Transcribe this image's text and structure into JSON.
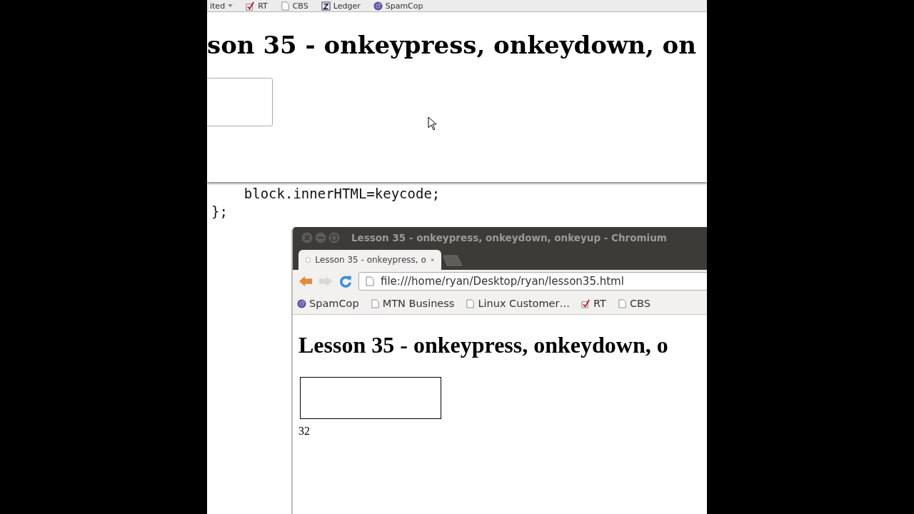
{
  "back_browser": {
    "bookmarks": [
      {
        "label": "ited",
        "kind": "dropdown"
      },
      {
        "label": "RT",
        "kind": "check"
      },
      {
        "label": "CBS",
        "kind": "page"
      },
      {
        "label": "Ledger",
        "kind": "ledger"
      },
      {
        "label": "SpamCop",
        "kind": "spiral"
      }
    ],
    "heading": "son 35 - onkeypress, onkeydown, on"
  },
  "editor": {
    "code_lines": [
      "    block.innerHTML=keycode;",
      "};"
    ]
  },
  "front_browser": {
    "title": "Lesson 35 - onkeypress, onkeydown, onkeyup - Chromium",
    "tabs": [
      {
        "label": "Lesson 35 - onkeypress, o",
        "selected": true
      }
    ],
    "address": "file:///home/ryan/Desktop/ryan/lesson35.html",
    "bookmarks": [
      {
        "label": "SpamCop",
        "kind": "spiral"
      },
      {
        "label": "MTN Business",
        "kind": "page"
      },
      {
        "label": "Linux Customer…",
        "kind": "page"
      },
      {
        "label": "RT",
        "kind": "check"
      },
      {
        "label": "CBS",
        "kind": "page"
      }
    ],
    "heading": "Lesson 35 - onkeypress, onkeydown, o",
    "output": "32"
  }
}
